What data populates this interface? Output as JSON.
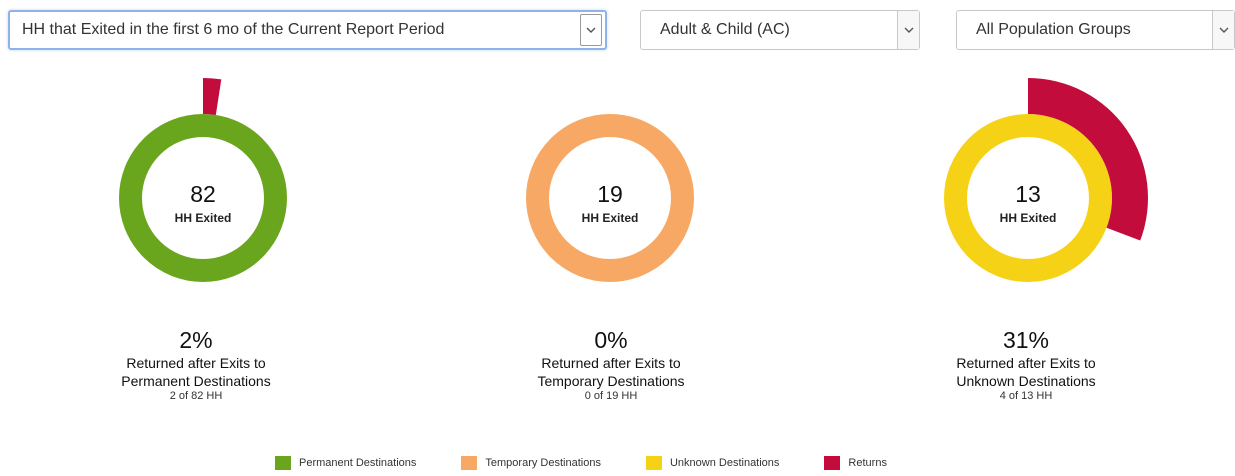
{
  "filters": {
    "period": "HH that Exited in the first 6 mo of the Current Report Period",
    "household": "Adult & Child (AC)",
    "population": "All Population Groups"
  },
  "colors": {
    "permanent": "#6aa51e",
    "temporary": "#f6a864",
    "unknown": "#f6d216",
    "returns": "#c20c3c"
  },
  "panels": [
    {
      "count": "82",
      "count_label": "HH Exited",
      "pct": "2%",
      "line1": "Returned after Exits to",
      "line2": "Permanent Destinations",
      "sub": "2 of 82 HH"
    },
    {
      "count": "19",
      "count_label": "HH Exited",
      "pct": "0%",
      "line1": "Returned after Exits to",
      "line2": "Temporary Destinations",
      "sub": "0 of 19 HH"
    },
    {
      "count": "13",
      "count_label": "HH Exited",
      "pct": "31%",
      "line1": "Returned after Exits to",
      "line2": "Unknown Destinations",
      "sub": "4 of 13 HH"
    }
  ],
  "chart_data": [
    {
      "type": "pie",
      "category": "Permanent Destinations",
      "exited": 82,
      "returned": 2,
      "color": "#6aa51e"
    },
    {
      "type": "pie",
      "category": "Temporary Destinations",
      "exited": 19,
      "returned": 0,
      "color": "#f6a864"
    },
    {
      "type": "pie",
      "category": "Unknown Destinations",
      "exited": 13,
      "returned": 4,
      "color": "#f6d216"
    }
  ],
  "legend": [
    {
      "label": "Permanent Destinations",
      "color": "#6aa51e"
    },
    {
      "label": "Temporary Destinations",
      "color": "#f6a864"
    },
    {
      "label": "Unknown Destinations",
      "color": "#f6d216"
    },
    {
      "label": "Returns",
      "color": "#c20c3c"
    }
  ]
}
